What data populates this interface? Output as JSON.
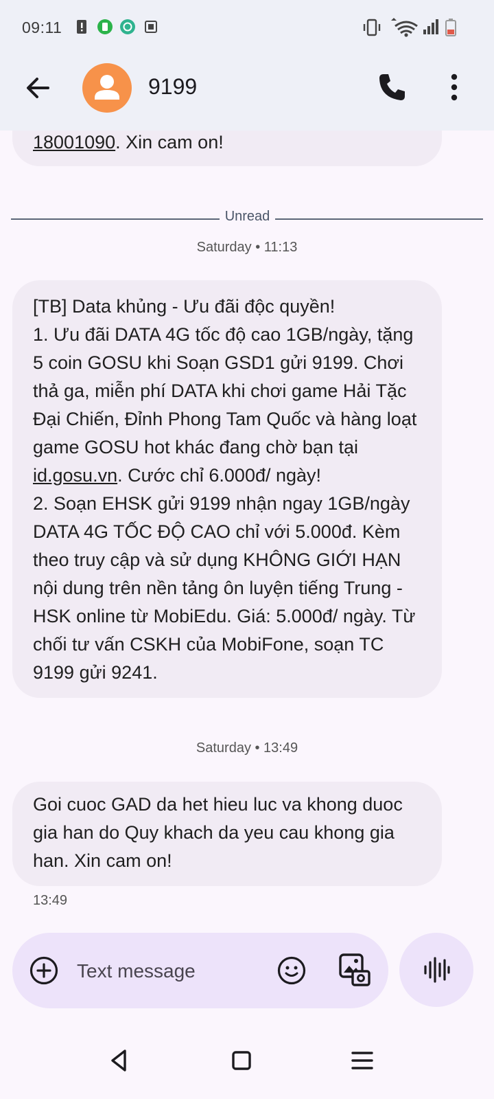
{
  "status_bar": {
    "time": "09:11"
  },
  "header": {
    "title": "9199",
    "icons": [
      "back-arrow-icon",
      "avatar-icon",
      "phone-icon",
      "more-vert-icon"
    ]
  },
  "conversation": {
    "previous_message": {
      "link": "18001090",
      "tail": ". Xin cam on!"
    },
    "unread_label": "Unread",
    "messages": [
      {
        "timestamp": "Saturday • 11:13",
        "part1": "[TB] Data khủng - Ưu đãi độc quyền!\n1. Ưu đãi DATA 4G tốc độ cao 1GB/ngày, tặng 5 coin GOSU khi Soạn GSD1 gửi 9199. Chơi thả ga, miễn phí DATA khi chơi game Hải Tặc Đại Chiến, Đỉnh Phong Tam Quốc và hàng loạt game GOSU hot khác đang chờ bạn tại ",
        "link": "id.gosu.vn",
        "part2": ". Cước chỉ 6.000đ/ ngày!\n2. Soạn EHSK gửi 9199 nhận ngay 1GB/ngày DATA 4G TỐC ĐỘ CAO chỉ với 5.000đ. Kèm theo truy cập và sử dụng KHÔNG GIỚI HẠN nội dung trên nền tảng ôn luyện tiếng Trung - HSK online từ MobiEdu. Giá: 5.000đ/ ngày. Từ chối tư vấn CSKH của MobiFone, soạn TC 9199 gửi 9241."
      },
      {
        "timestamp": "Saturday • 13:49",
        "text": "Goi cuoc GAD da het hieu luc va khong duoc gia han do Quy khach da yeu cau khong gia han. Xin cam on!",
        "time": "13:49"
      }
    ]
  },
  "composer": {
    "placeholder": "Text message",
    "icons": [
      "add-icon",
      "emoji-icon",
      "gallery-icon",
      "voice-icon"
    ]
  },
  "navigation": {
    "icons": [
      "back-triangle-icon",
      "home-square-icon",
      "menu-lines-icon"
    ]
  },
  "colors": {
    "avatar": "#f7924a",
    "header_bg": "#eef0f7",
    "bubble_bg": "#f1ebf4",
    "composer_bg": "#ede3fa"
  }
}
